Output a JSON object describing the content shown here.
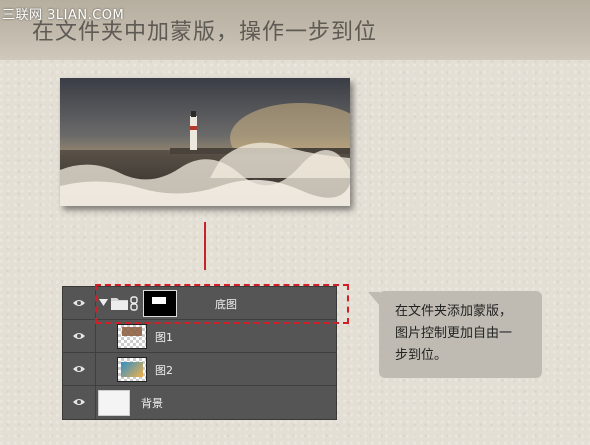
{
  "header": {
    "watermark": "三联网 3LIAN.COM",
    "title": "在文件夹中加蒙版，操作一步到位"
  },
  "layers": {
    "group": {
      "name": "底图",
      "mask": "white-rect-on-black"
    },
    "layer1": {
      "name": "图1"
    },
    "layer2": {
      "name": "图2"
    },
    "background": {
      "name": "背景"
    }
  },
  "callout": {
    "text": "在文件夹添加蒙版，\n图片控制更加自由一\n步到位。"
  },
  "colors": {
    "panel": "#555555",
    "highlight": "#d21e26",
    "connector": "#c0232a",
    "callout_bg": "#bfbbb3"
  }
}
